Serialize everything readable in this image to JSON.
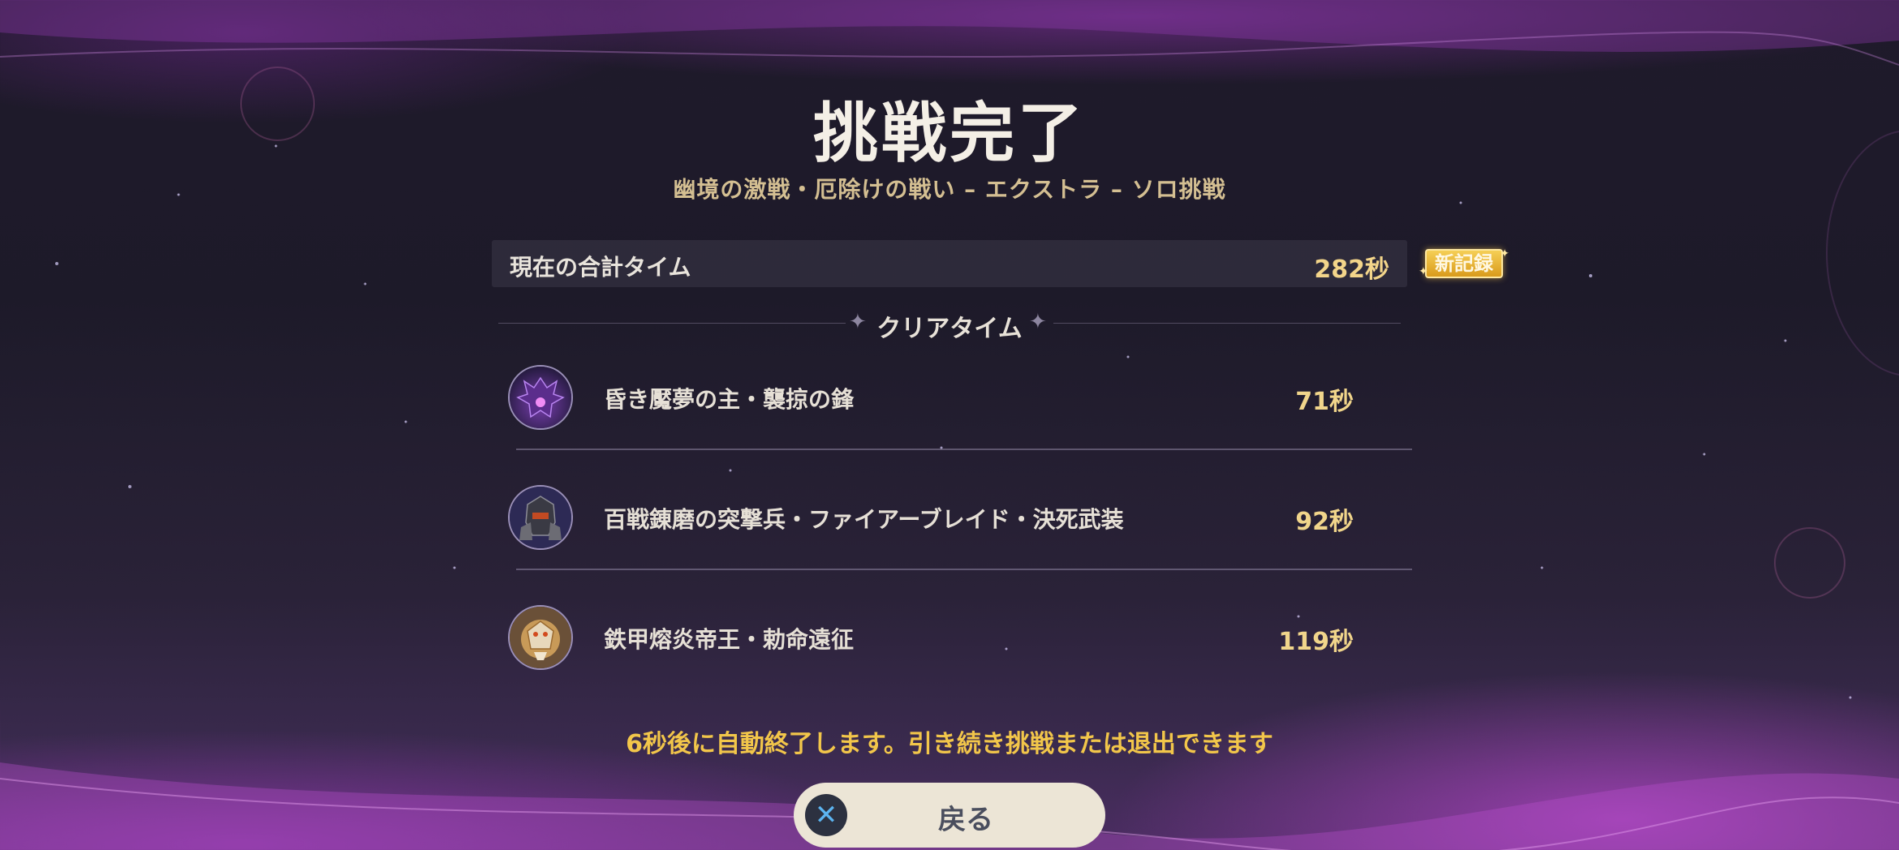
{
  "title": "挑戦完了",
  "subtitle": "幽境の激戦・厄除けの戦い – エクストラ – ソロ挑戦",
  "total": {
    "label": "現在の合計タイム",
    "value": "282秒",
    "badge": "新記録"
  },
  "section_label": "クリアタイム",
  "bosses": [
    {
      "name": "昏き魘夢の主・襲掠の鋒",
      "time": "71秒",
      "icon": "shadow-dragon-icon"
    },
    {
      "name": "百戦錬磨の突撃兵・ファイアーブレイド・決死武装",
      "time": "92秒",
      "icon": "armored-soldier-icon"
    },
    {
      "name": "鉄甲熔炎帝王・勅命遠征",
      "time": "119秒",
      "icon": "lava-emperor-icon"
    }
  ],
  "auto_exit_message": "6秒後に自動終了します。引き続き挑戦または退出できます",
  "back_button": {
    "label": "戻る",
    "icon": "cross-button-icon"
  },
  "colors": {
    "title": "#f4efe6",
    "subtitle": "#d4bf92",
    "time_value": "#f3d58a",
    "badge": "#e8b232",
    "auto_message": "#f2c64a",
    "button_bg": "#ece5d6",
    "button_icon": "#5cb4f0"
  }
}
